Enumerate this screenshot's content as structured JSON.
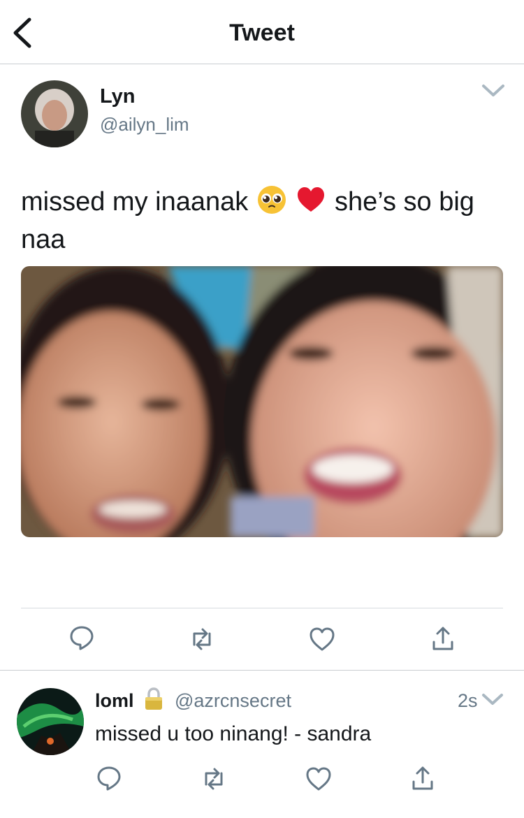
{
  "header": {
    "title": "Tweet",
    "back_icon": "chevron-left-icon"
  },
  "tweet": {
    "author": {
      "name": "Lyn",
      "handle": "@ailyn_lim"
    },
    "text_part1": "missed my inaanak",
    "emojis": [
      "pleading-face-emoji",
      "red-heart-emoji"
    ],
    "text_part2": "she’s so big naa",
    "media": "photo of two smiling faces",
    "actions": [
      "reply-icon",
      "retweet-icon",
      "like-icon",
      "share-icon"
    ]
  },
  "reply": {
    "author": {
      "name": "loml",
      "handle": "@azrcnsecret",
      "protected": true
    },
    "time": "2s",
    "text": "missed u too ninang! - sandra",
    "actions": [
      "reply-icon",
      "retweet-icon",
      "like-icon",
      "share-icon"
    ]
  },
  "colors": {
    "secondary": "#657786",
    "divider": "#d6dbe0",
    "heart": "#e0245e"
  }
}
